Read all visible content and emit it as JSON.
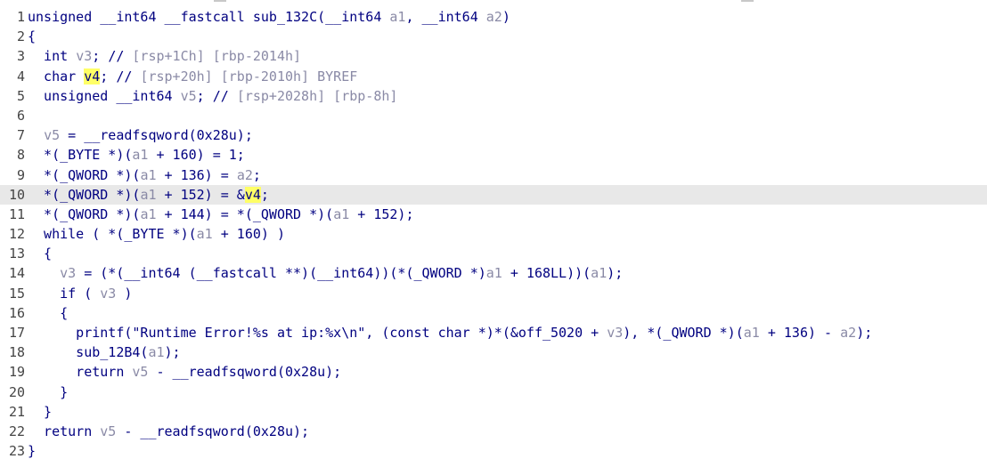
{
  "editor": {
    "lines": [
      {
        "n": "1",
        "code": "unsigned __int64 __fastcall sub_132C(__int64 a1, __int64 a2)"
      },
      {
        "n": "2",
        "code": "{"
      },
      {
        "n": "3",
        "code": "  int v3; // [rsp+1Ch] [rbp-2014h]"
      },
      {
        "n": "4",
        "code": "  char v4; // [rsp+20h] [rbp-2010h] BYREF"
      },
      {
        "n": "5",
        "code": "  unsigned __int64 v5; // [rsp+2028h] [rbp-8h]"
      },
      {
        "n": "6",
        "code": ""
      },
      {
        "n": "7",
        "code": "  v5 = __readfsqword(0x28u);"
      },
      {
        "n": "8",
        "code": "  *(_BYTE *)(a1 + 160) = 1;"
      },
      {
        "n": "9",
        "code": "  *(_QWORD *)(a1 + 136) = a2;"
      },
      {
        "n": "10",
        "code": "  *(_QWORD *)(a1 + 152) = &v4;"
      },
      {
        "n": "11",
        "code": "  *(_QWORD *)(a1 + 144) = *(_QWORD *)(a1 + 152);"
      },
      {
        "n": "12",
        "code": "  while ( *(_BYTE *)(a1 + 160) )"
      },
      {
        "n": "13",
        "code": "  {"
      },
      {
        "n": "14",
        "code": "    v3 = (*(__int64 (__fastcall **)(__int64))(*(_QWORD *)a1 + 168LL))(a1);"
      },
      {
        "n": "15",
        "code": "    if ( v3 )"
      },
      {
        "n": "16",
        "code": "    {"
      },
      {
        "n": "17",
        "code": "      printf(\"Runtime Error!%s at ip:%x\\n\", (const char *)*(&off_5020 + v3), *(_QWORD *)(a1 + 136) - a2);"
      },
      {
        "n": "18",
        "code": "      sub_12B4(a1);"
      },
      {
        "n": "19",
        "code": "      return v5 - __readfsqword(0x28u);"
      },
      {
        "n": "20",
        "code": "    }"
      },
      {
        "n": "21",
        "code": "  }"
      },
      {
        "n": "22",
        "code": "  return v5 - __readfsqword(0x28u);"
      },
      {
        "n": "23",
        "code": "}"
      }
    ],
    "current_line": "10",
    "highlighted_token": "v4",
    "colors": {
      "code": "#000080",
      "variable": "#8a8aa6",
      "highlight": "#ffff66",
      "current_line_bg": "#e8e8e8"
    }
  }
}
